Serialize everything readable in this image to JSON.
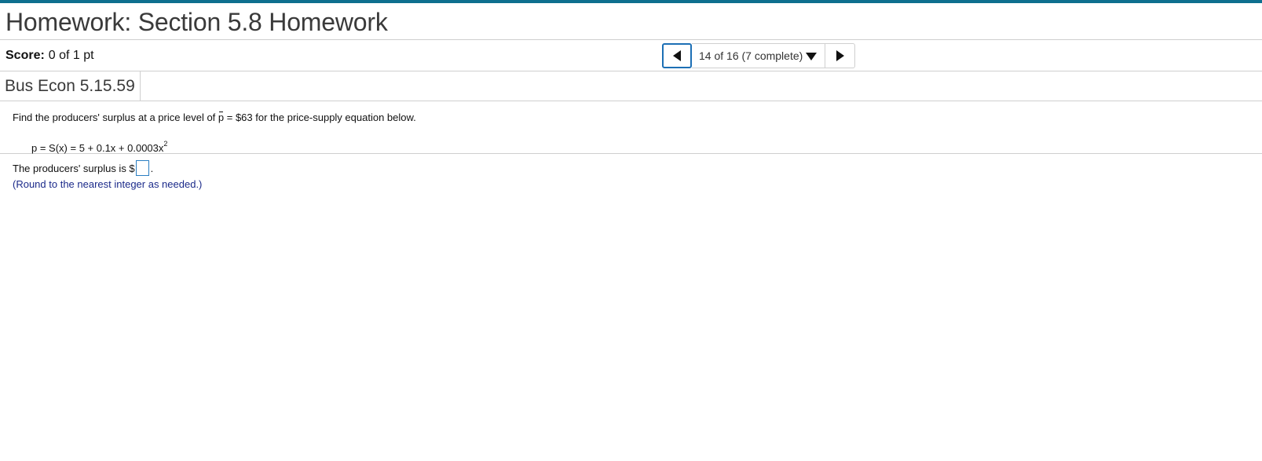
{
  "header": {
    "title": "Homework: Section 5.8 Homework"
  },
  "score": {
    "label": "Score:",
    "value": "0 of 1 pt"
  },
  "navigation": {
    "progress_text": "14 of 16 (7 complete)"
  },
  "question": {
    "id": "Bus Econ 5.15.59",
    "prompt_before": "Find the producers' surplus at a price level of ",
    "price_symbol": "p",
    "prompt_after": " = $63 for the price-supply equation below.",
    "equation_main": "p = S(x) = 5 + 0.1x + 0.0003x",
    "equation_exponent": "2",
    "answer_prefix": "The producers' surplus is $",
    "answer_value": "",
    "answer_suffix": ".",
    "hint": "(Round to the nearest integer as needed.)"
  },
  "colors": {
    "accent_bar": "#0e6f8f",
    "focus_border": "#1c6fb5",
    "hint_text": "#1b2a8a"
  },
  "icons": {
    "prev": "triangle-left-icon",
    "next": "triangle-right-icon",
    "dropdown": "triangle-down-icon"
  }
}
